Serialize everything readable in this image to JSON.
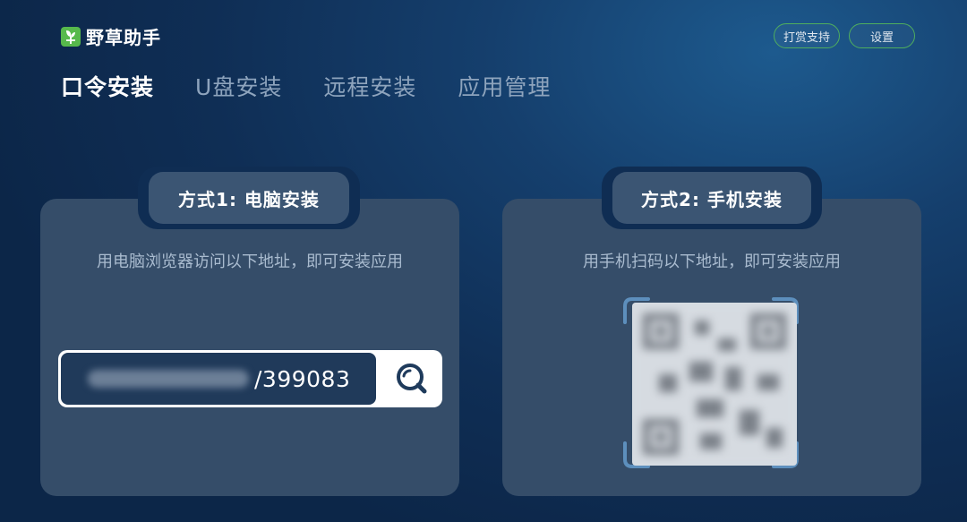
{
  "app": {
    "title": "野草助手"
  },
  "header": {
    "tip_button": "打赏支持",
    "settings_button": "设置"
  },
  "tabs": [
    {
      "label": "口令安装",
      "active": true
    },
    {
      "label": "U盘安装",
      "active": false
    },
    {
      "label": "远程安装",
      "active": false
    },
    {
      "label": "应用管理",
      "active": false
    }
  ],
  "method1": {
    "title": "方式1: 电脑安装",
    "description": "用电脑浏览器访问以下地址，即可安装应用",
    "url_suffix": "/399083"
  },
  "method2": {
    "title": "方式2: 手机安装",
    "description": "用手机扫码以下地址，即可安装应用"
  },
  "colors": {
    "accent_green": "#4fae5e",
    "panel": "#354d69",
    "background": "#0f2e55"
  },
  "icons": {
    "logo": "leaf-logo-icon",
    "search": "search-icon",
    "qr": "qr-code"
  }
}
